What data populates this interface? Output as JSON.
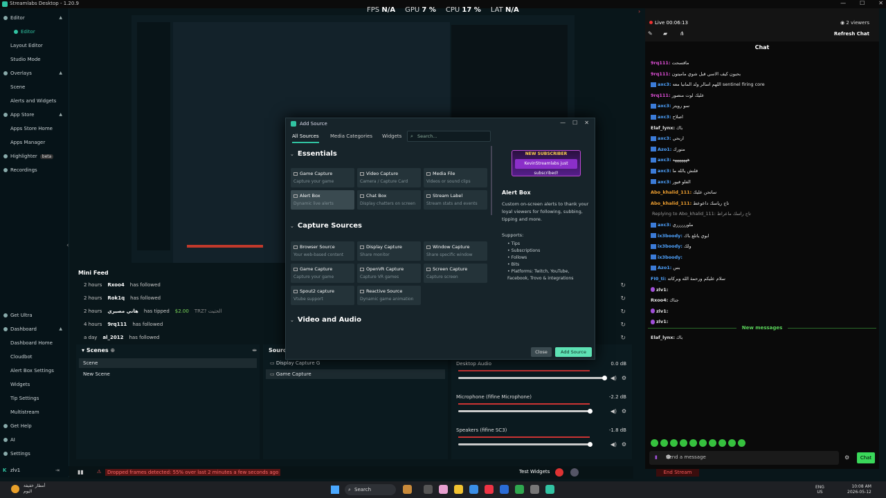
{
  "app": {
    "title": "Streamlabs Desktop - 1.20.9"
  },
  "window_controls": [
    "—",
    "☐",
    "✕"
  ],
  "stats": [
    {
      "label": "FPS",
      "value": "N/A"
    },
    {
      "label": "GPU",
      "value": "7 %"
    },
    {
      "label": "CPU",
      "value": "17 %"
    },
    {
      "label": "LAT",
      "value": "N/A"
    }
  ],
  "sidebar": {
    "items": [
      {
        "label": "Editor",
        "type": "header"
      },
      {
        "label": "Editor",
        "type": "sub",
        "active": true
      },
      {
        "label": "Layout Editor",
        "type": "sub"
      },
      {
        "label": "Studio Mode",
        "type": "sub"
      },
      {
        "label": "Overlays",
        "type": "header"
      },
      {
        "label": "Scene",
        "type": "sub"
      },
      {
        "label": "Alerts and Widgets",
        "type": "sub"
      },
      {
        "label": "App Store",
        "type": "header"
      },
      {
        "label": "Apps Store Home",
        "type": "sub"
      },
      {
        "label": "Apps Manager",
        "type": "sub"
      },
      {
        "label": "Highlighter",
        "type": "header",
        "badge": "beta"
      },
      {
        "label": "Recordings",
        "type": "header"
      },
      {
        "label": "Get Ultra",
        "type": "header"
      },
      {
        "label": "Dashboard",
        "type": "header"
      },
      {
        "label": "Dashboard Home",
        "type": "sub"
      },
      {
        "label": "Cloudbot",
        "type": "sub"
      },
      {
        "label": "Alert Box Settings",
        "type": "sub"
      },
      {
        "label": "Widgets",
        "type": "sub"
      },
      {
        "label": "Tip Settings",
        "type": "sub"
      },
      {
        "label": "Multistream",
        "type": "sub"
      },
      {
        "label": "Get Help",
        "type": "header"
      },
      {
        "label": "AI",
        "type": "header"
      },
      {
        "label": "Settings",
        "type": "header"
      }
    ],
    "user": "zlv1"
  },
  "minifeed": {
    "title": "Mini Feed",
    "rows": [
      {
        "time": "2 hours",
        "user": "Rxoo4",
        "action": "has followed",
        "extra": ""
      },
      {
        "time": "2 hours",
        "user": "Rok1q",
        "action": "has followed",
        "extra": ""
      },
      {
        "time": "2 hours",
        "user": "هاني مصيري",
        "action": "has tipped",
        "extra": "$2.00",
        "note": "TRZ? الحتيت"
      },
      {
        "time": "4 hours",
        "user": "9rq111",
        "action": "has followed",
        "extra": ""
      },
      {
        "time": "a day",
        "user": "al_2012",
        "action": "has followed",
        "extra": ""
      }
    ]
  },
  "scenes": {
    "title": "Scenes",
    "items": [
      "Scene",
      "New Scene"
    ],
    "selected": 0
  },
  "sources": {
    "title": "Sources",
    "items": [
      "Display Capture G",
      "Game Capture"
    ],
    "selected": 1
  },
  "mixer": {
    "channels": [
      {
        "name": "Desktop Audio",
        "db": "0.0 dB",
        "level": 1.0
      },
      {
        "name": "Microphone (fifine Microphone)",
        "db": "-2.2 dB",
        "level": 0.9
      },
      {
        "name": "Speakers (fifine SC3)",
        "db": "-1.8 dB",
        "level": 0.9
      }
    ]
  },
  "footer": {
    "warning": "Dropped frames detected: 55% over last 2 minutes a few seconds ago",
    "test_widgets": "Test Widgets",
    "end_stream": "End Stream"
  },
  "dialog": {
    "title": "Add Source",
    "tabs": [
      "All Sources",
      "Media Categories",
      "Widgets"
    ],
    "search_placeholder": "Search...",
    "sections": [
      {
        "title": "Essentials",
        "cards": [
          {
            "title": "Game Capture",
            "sub": "Capture your game"
          },
          {
            "title": "Video Capture",
            "sub": "Camera / Capture Card"
          },
          {
            "title": "Media File",
            "sub": "Videos or sound clips"
          },
          {
            "title": "Alert Box",
            "sub": "Dynamic live alerts",
            "selected": true
          },
          {
            "title": "Chat Box",
            "sub": "Display chatters on screen"
          },
          {
            "title": "Stream Label",
            "sub": "Stream stats and events"
          }
        ]
      },
      {
        "title": "Capture Sources",
        "cards": [
          {
            "title": "Browser Source",
            "sub": "Your web-based content"
          },
          {
            "title": "Display Capture",
            "sub": "Share monitor"
          },
          {
            "title": "Window Capture",
            "sub": "Share specific window"
          },
          {
            "title": "Game Capture",
            "sub": "Capture your game"
          },
          {
            "title": "OpenVR Capture",
            "sub": "Capture VR games"
          },
          {
            "title": "Screen Capture",
            "sub": "Capture screen"
          },
          {
            "title": "Spout2 capture",
            "sub": "Vtube support"
          },
          {
            "title": "Reactive Source",
            "sub": "Dynamic game animation"
          }
        ]
      },
      {
        "title": "Video and Audio",
        "cards": []
      }
    ],
    "detail": {
      "banner_top": "NEW SUBSCRIBER",
      "banner_main": "KevinStreamlabs just subscribed!",
      "title": "Alert Box",
      "description": "Custom on-screen alerts to thank your loyal viewers for following, subbing, tipping and more.",
      "supports_label": "Supports:",
      "supports": [
        "Tips",
        "Subscriptions",
        "Follows",
        "Bits",
        "Platforms: Twitch, YouTube, Facebook, Trovo & integrations"
      ]
    },
    "close_label": "Close",
    "add_label": "Add Source"
  },
  "chat": {
    "live": "Live 00:06:13",
    "viewers": "2 viewers",
    "refresh": "Refresh Chat",
    "header": "Chat",
    "messages": [
      {
        "user": "9rq111:",
        "text": "ماقسحت",
        "color": "#e04fd8",
        "badge": "none"
      },
      {
        "user": "9rq111:",
        "text": "بحبون كيف الاسي قبل شوي ماميتون",
        "color": "#e04fd8",
        "badge": "none"
      },
      {
        "user": "axc3:",
        "text": "اللهم اسالر ولد المانيا معه sentinel firing core",
        "color": "#4fa3ff",
        "badge": "tag"
      },
      {
        "user": "9rq111:",
        "text": "عليك لوت منصور",
        "color": "#e04fd8",
        "badge": "none"
      },
      {
        "user": "axc3:",
        "text": "سو رويتر",
        "color": "#4fa3ff",
        "badge": "tag"
      },
      {
        "user": "axc3:",
        "text": "اصلاح",
        "color": "#4fa3ff",
        "badge": "tag"
      },
      {
        "user": "Elaf_lynx:",
        "text": "باك",
        "color": "#e6e6e6",
        "badge": "none"
      },
      {
        "user": "axc3:",
        "text": "اربحي",
        "color": "#4fa3ff",
        "badge": "tag"
      },
      {
        "user": "Azo1:",
        "text": "متورك",
        "color": "#4fa3ff",
        "badge": "tag"
      },
      {
        "user": "axc3:",
        "text": "هههههههه",
        "color": "#4fa3ff",
        "badge": "tag"
      },
      {
        "user": "axc3:",
        "text": "قلنش يالله ما",
        "color": "#4fa3ff",
        "badge": "tag"
      },
      {
        "user": "axc3:",
        "text": "الفلو فيور",
        "color": "#4fa3ff",
        "badge": "tag"
      },
      {
        "user": "Abo_khalid_111:",
        "text": "ساتحن عليك",
        "color": "#f0a030",
        "badge": "none"
      },
      {
        "user": "Abo_khalid_111:",
        "text": "تاج رياسك داعوعط",
        "color": "#f0a030",
        "badge": "none"
      },
      {
        "user": "",
        "text": "Replying to Abo_khalid_111: تاج راسك ماعراط",
        "color": "#999999",
        "badge": "none"
      },
      {
        "user": "axc3:",
        "text": "ملوررررري",
        "color": "#4fa3ff",
        "badge": "tag"
      },
      {
        "user": "ix3boody:",
        "text": "ابوي ياتلع باك",
        "color": "#4fa3ff",
        "badge": "tag"
      },
      {
        "user": "ix3boody:",
        "text": "ولك",
        "color": "#4fa3ff",
        "badge": "tag"
      },
      {
        "user": "ix3boody:",
        "text": "",
        "color": "#4fa3ff",
        "badge": "tag"
      },
      {
        "user": "Azo1:",
        "text": "بس",
        "color": "#4fa3ff",
        "badge": "tag"
      },
      {
        "user": "FI0_ti:",
        "text": "سلام عليكم ورحمة الله وبركاته",
        "color": "#4fa3ff",
        "badge": "none"
      },
      {
        "user": "zlv1:",
        "text": "",
        "color": "#e6e6e6",
        "badge": "pin"
      },
      {
        "user": "Rxoo4:",
        "text": "جناك",
        "color": "#e6e6e6",
        "badge": "none"
      },
      {
        "user": "zlv1:",
        "text": "",
        "color": "#e6e6e6",
        "badge": "pin"
      },
      {
        "user": "zlv1:",
        "text": "",
        "color": "#e6e6e6",
        "badge": "pin"
      }
    ],
    "new_messages": "New messages",
    "after": {
      "user": "Elaf_lynx:",
      "text": "باك"
    },
    "input_placeholder": "Send a message",
    "chat_button": "Chat"
  },
  "taskbar": {
    "weather": [
      "أمطار خفيفة",
      "اليوم"
    ],
    "search": "Search",
    "lang": [
      "ENG",
      "US"
    ],
    "time": "10:08 AM",
    "date": "2026-05-12"
  }
}
